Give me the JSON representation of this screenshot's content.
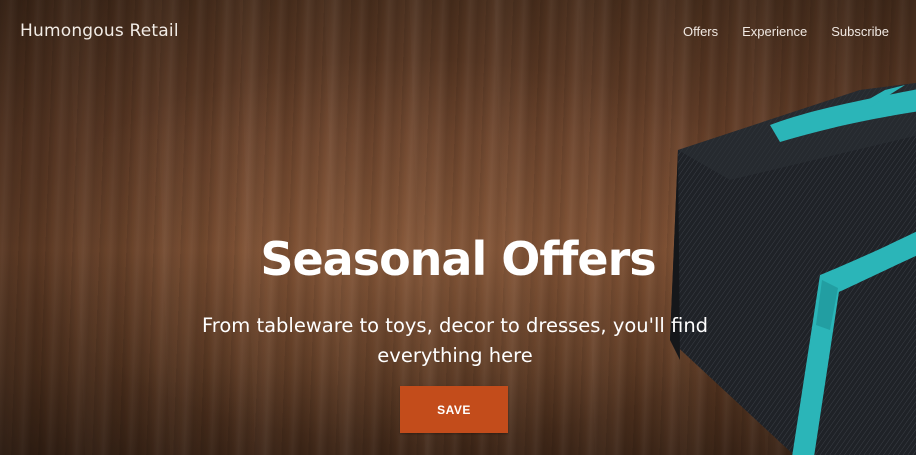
{
  "header": {
    "brand": "Humongous Retail",
    "nav": [
      {
        "label": "Offers"
      },
      {
        "label": "Experience"
      },
      {
        "label": "Subscribe"
      }
    ]
  },
  "hero": {
    "title": "Seasonal Offers",
    "subtitle": "From tableware to toys, decor to dresses, you'll find everything here",
    "cta_label": "SAVE"
  },
  "colors": {
    "cta": "#c34c1b",
    "ribbon": "#2bb5b8",
    "gift_box": "#22252a"
  }
}
